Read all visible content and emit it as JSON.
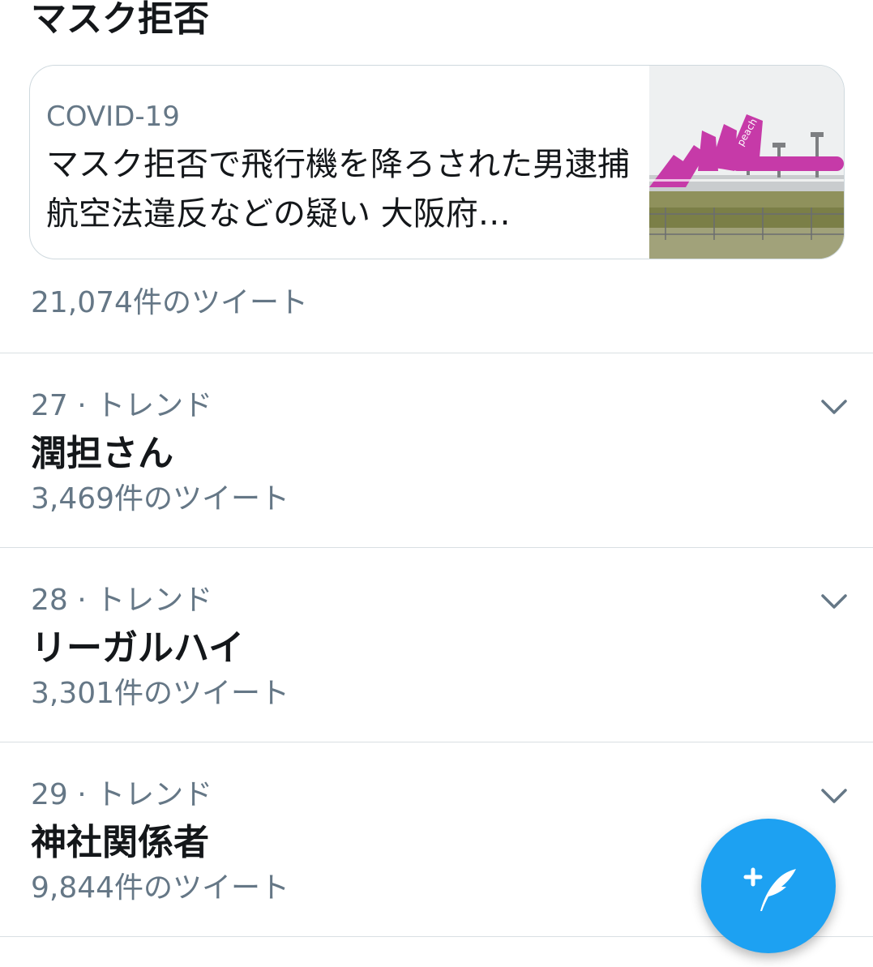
{
  "top_trend": {
    "title": "マスク拒否",
    "card": {
      "category": "COVID-19",
      "headline": "マスク拒否で飛行機を降ろされた男逮捕 航空法違反などの疑い 大阪府…",
      "thumbnail": "airplanes-photo"
    },
    "tweet_count": "21,074件のツイート"
  },
  "trends": [
    {
      "meta": "27 · トレンド",
      "name": "潤担さん",
      "count": "3,469件のツイート"
    },
    {
      "meta": "28 · トレンド",
      "name": "リーガルハイ",
      "count": "3,301件のツイート"
    },
    {
      "meta": "29 · トレンド",
      "name": "神社関係者",
      "count": "9,844件のツイート"
    }
  ],
  "icons": {
    "more": "chevron-down-icon",
    "compose": "compose-tweet-icon"
  },
  "colors": {
    "accent": "#1da1f2",
    "secondary_text": "#657786",
    "primary_text": "#14171a",
    "divider": "#d9dfe3",
    "plane_livery": "#c63aa8"
  }
}
